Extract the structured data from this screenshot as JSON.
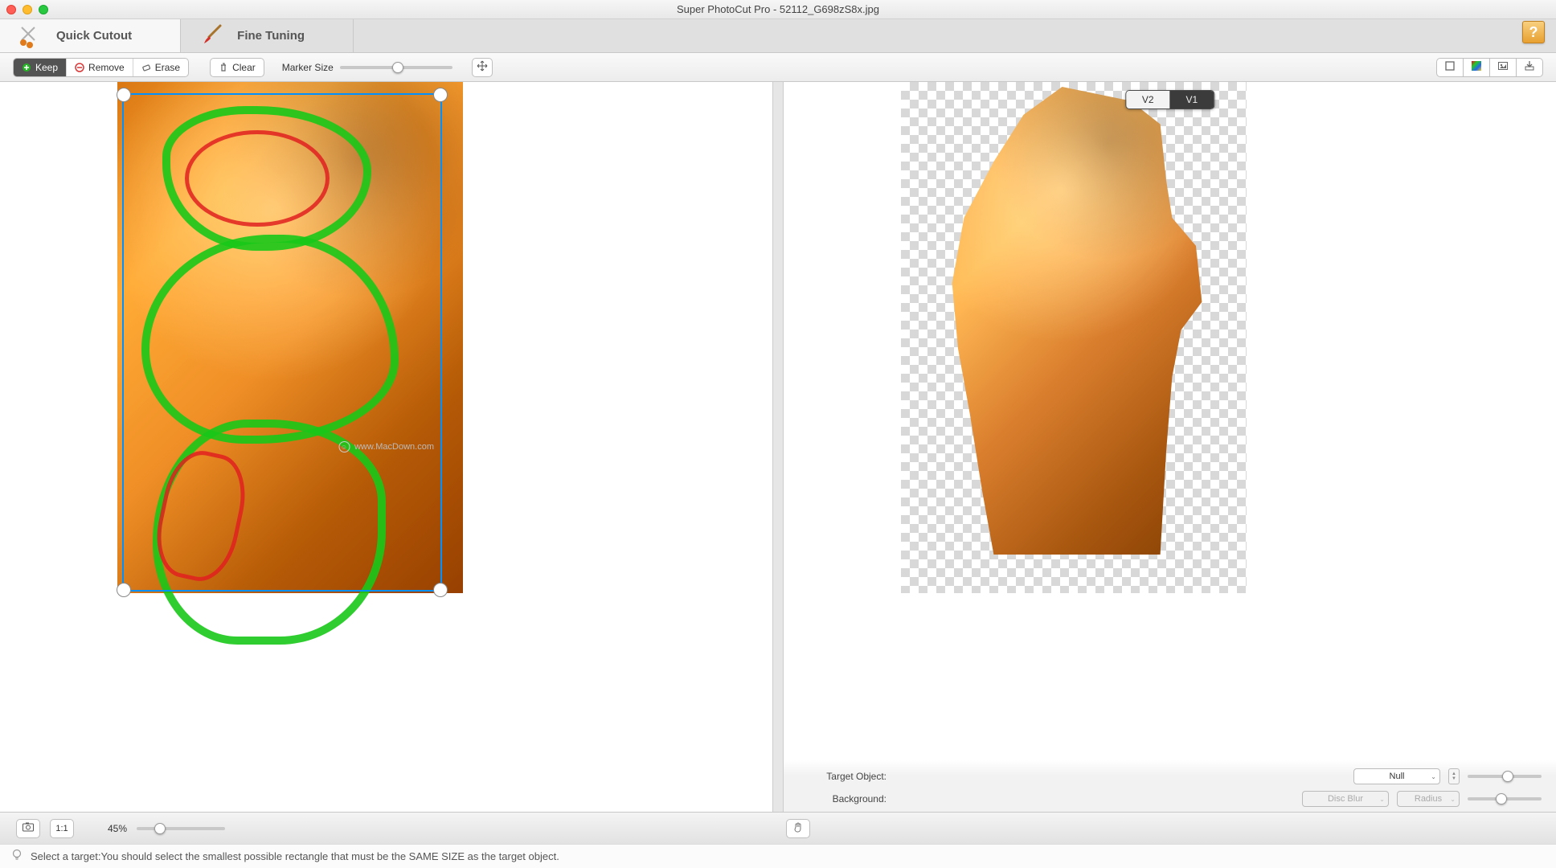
{
  "window": {
    "title": "Super PhotoCut Pro - 52112_G698zS8x.jpg"
  },
  "tabs": {
    "quick": "Quick Cutout",
    "fine": "Fine Tuning",
    "active": "quick"
  },
  "toolbar": {
    "keep": "Keep",
    "remove": "Remove",
    "erase": "Erase",
    "clear": "Clear",
    "marker_size_label": "Marker Size",
    "marker_size_value": 52
  },
  "version_toggle": {
    "v2": "V2",
    "v1": "V1",
    "selected": "V1"
  },
  "result_controls": {
    "target_object_label": "Target Object:",
    "target_object_value": "Null",
    "background_label": "Background:",
    "background_value": "Disc Blur",
    "radius_label": "Radius"
  },
  "footer": {
    "one_to_one": "1:1",
    "zoom_percent": "45%",
    "zoom_value": 45
  },
  "status": {
    "tip": "Select a target:You should select the smallest possible rectangle that must be the SAME SIZE as the target object."
  },
  "icons": {
    "help": "?",
    "plus": "+",
    "minus": "−",
    "eraser": "◇",
    "trash": "🗑",
    "move": "✥",
    "fit": "⛶",
    "color": "▦",
    "image": "🖼",
    "export": "⤓",
    "camera": "◧",
    "hand": "✋",
    "bulb": "💡"
  },
  "watermark": "www.MacDown.com"
}
